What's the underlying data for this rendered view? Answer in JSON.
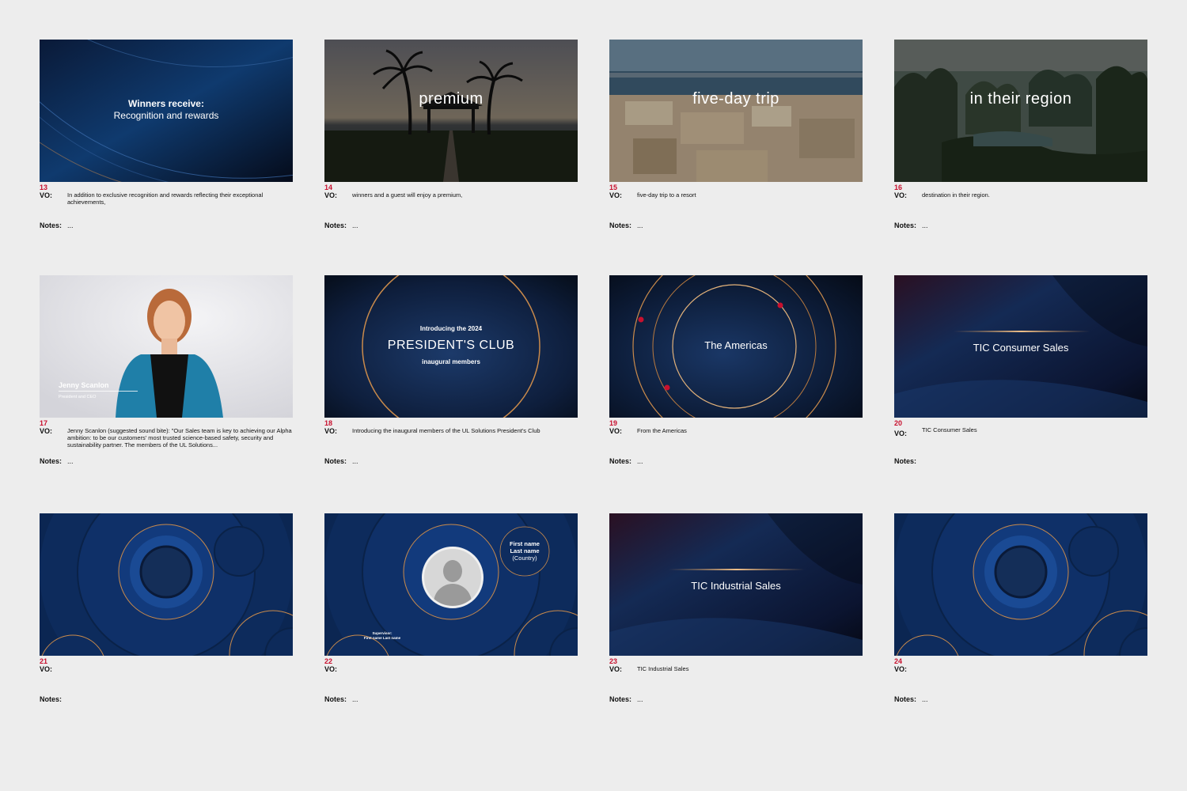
{
  "colors": {
    "accent_red": "#c8102e",
    "navy": "#0d2a55",
    "gold": "#c98a4b",
    "page_bg": "#ededed"
  },
  "slides": [
    {
      "number": "13",
      "vo_label": "VO:",
      "vo": "In addition to exclusive recognition and rewards reflecting their exceptional achievements,",
      "notes_label": "Notes:",
      "notes": "...",
      "visual": {
        "line1": "Winners receive:",
        "line2": "Recognition and rewards"
      }
    },
    {
      "number": "14",
      "vo_label": "VO:",
      "vo": "winners and a guest will enjoy a premium,",
      "notes_label": "Notes:",
      "notes": "...",
      "visual": {
        "caption": "premium"
      }
    },
    {
      "number": "15",
      "vo_label": "VO:",
      "vo": "five-day trip to a resort",
      "notes_label": "Notes:",
      "notes": "...",
      "visual": {
        "caption": "five-day trip"
      }
    },
    {
      "number": "16",
      "vo_label": "VO:",
      "vo": "destination in their region.",
      "notes_label": "Notes:",
      "notes": "...",
      "visual": {
        "caption": "in their region"
      }
    },
    {
      "number": "17",
      "vo_label": "VO:",
      "vo": "Jenny Scanlon (suggested sound bite): \"Our Sales team is key to achieving our Alpha ambition: to be our customers' most trusted science-based safety, security and sustainability partner. The members of the UL Solutions...",
      "notes_label": "Notes:",
      "notes": "...",
      "visual": {
        "name": "Jenny Scanlon",
        "title": "President and CEO"
      }
    },
    {
      "number": "18",
      "vo_label": "VO:",
      "vo": "Introducing the inaugural members of the UL Solutions President's Club",
      "notes_label": "Notes:",
      "notes": "...",
      "visual": {
        "line1": "Introducing the 2024",
        "title": "PRESIDENT'S CLUB",
        "line3": "inaugural members"
      }
    },
    {
      "number": "19",
      "vo_label": "VO:",
      "vo": "From the Americas",
      "notes_label": "Notes:",
      "notes": "...",
      "visual": {
        "caption": "The Americas"
      }
    },
    {
      "number": "20",
      "vo_label": "VO:",
      "vo": "TIC Consumer Sales",
      "notes_label": "Notes:",
      "notes": "",
      "visual": {
        "caption": "TIC Consumer Sales"
      }
    },
    {
      "number": "21",
      "vo_label": "VO:",
      "vo": "",
      "notes_label": "Notes:",
      "notes": "",
      "visual": {}
    },
    {
      "number": "22",
      "vo_label": "VO:",
      "vo": "",
      "notes_label": "Notes:",
      "notes": "...",
      "visual": {
        "first_name": "First name",
        "last_name": "Last name",
        "country": "(Country)",
        "sup_label": "Supervisor:",
        "sup_name": "First name Last name"
      }
    },
    {
      "number": "23",
      "vo_label": "VO:",
      "vo": "TIC Industrial Sales",
      "notes_label": "Notes:",
      "notes": "...",
      "visual": {
        "caption": "TIC Industrial Sales"
      }
    },
    {
      "number": "24",
      "vo_label": "VO:",
      "vo": "",
      "notes_label": "Notes:",
      "notes": "...",
      "visual": {}
    }
  ]
}
